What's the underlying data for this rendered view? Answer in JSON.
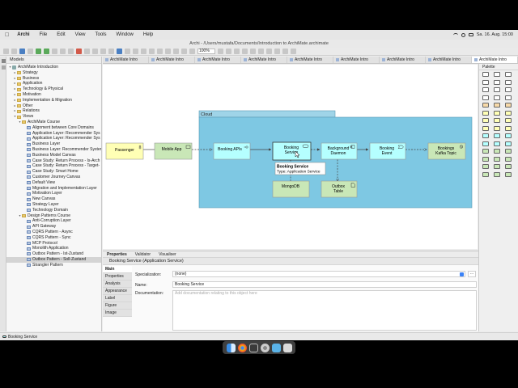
{
  "menubar": {
    "app": "Archi",
    "items": [
      "File",
      "Edit",
      "View",
      "Tools",
      "Window",
      "Help"
    ],
    "clock": "Sa. 16. Aug.  15:00"
  },
  "window": {
    "title": "Archi - /Users/mustafa/Documents/Introduction to ArchiMate.archimate"
  },
  "toolbar": {
    "zoom": "100%"
  },
  "models": {
    "header": "Models",
    "tree": [
      {
        "label": "ArchiMate Introduction",
        "level": 0,
        "icon": "model",
        "twisty": "open"
      },
      {
        "label": "Strategy",
        "level": 1,
        "icon": "folder",
        "twisty": "closed"
      },
      {
        "label": "Business",
        "level": 1,
        "icon": "folder",
        "twisty": "closed"
      },
      {
        "label": "Application",
        "level": 1,
        "icon": "folder",
        "twisty": "closed"
      },
      {
        "label": "Technology & Physical",
        "level": 1,
        "icon": "folder",
        "twisty": "closed"
      },
      {
        "label": "Motivation",
        "level": 1,
        "icon": "folder",
        "twisty": "closed"
      },
      {
        "label": "Implementation & Migration",
        "level": 1,
        "icon": "folder",
        "twisty": "closed"
      },
      {
        "label": "Other",
        "level": 1,
        "icon": "folder",
        "twisty": "closed"
      },
      {
        "label": "Relations",
        "level": 1,
        "icon": "folder",
        "twisty": "closed"
      },
      {
        "label": "Views",
        "level": 1,
        "icon": "folder",
        "twisty": "open"
      },
      {
        "label": "ArchiMate Course",
        "level": 2,
        "icon": "folder",
        "twisty": "open"
      },
      {
        "label": "Alignment between Core Domains",
        "level": 3,
        "icon": "view"
      },
      {
        "label": "Application Layer: Recommender Sys",
        "level": 3,
        "icon": "view"
      },
      {
        "label": "Application Layer: Recommender Sys",
        "level": 3,
        "icon": "view"
      },
      {
        "label": "Business Layer",
        "level": 3,
        "icon": "view"
      },
      {
        "label": "Business Layer: Recommender Syster",
        "level": 3,
        "icon": "view"
      },
      {
        "label": "Business Model Canvas",
        "level": 3,
        "icon": "view"
      },
      {
        "label": "Case Study: Return Process - Is-Arch",
        "level": 3,
        "icon": "view"
      },
      {
        "label": "Case Study: Return Process - Target-",
        "level": 3,
        "icon": "view"
      },
      {
        "label": "Case Study: Smart Home",
        "level": 3,
        "icon": "view"
      },
      {
        "label": "Customer Journey Canvas",
        "level": 3,
        "icon": "view"
      },
      {
        "label": "Default View",
        "level": 3,
        "icon": "view"
      },
      {
        "label": "Migration and Implementation Layer",
        "level": 3,
        "icon": "view"
      },
      {
        "label": "Motivation Layer",
        "level": 3,
        "icon": "view"
      },
      {
        "label": "New Canvas",
        "level": 3,
        "icon": "view"
      },
      {
        "label": "Strategy Layer",
        "level": 3,
        "icon": "view"
      },
      {
        "label": "Technology Domain",
        "level": 3,
        "icon": "view"
      },
      {
        "label": "Design Patterns Course",
        "level": 2,
        "icon": "folder",
        "twisty": "open"
      },
      {
        "label": "Anti-Corruption Layer",
        "level": 3,
        "icon": "view"
      },
      {
        "label": "API Gateway",
        "level": 3,
        "icon": "view"
      },
      {
        "label": "CQRS Pattern - Async",
        "level": 3,
        "icon": "view"
      },
      {
        "label": "CQRS Pattern - Sync",
        "level": 3,
        "icon": "view"
      },
      {
        "label": "MCP Protocol",
        "level": 3,
        "icon": "view"
      },
      {
        "label": "Monolith Application",
        "level": 3,
        "icon": "view"
      },
      {
        "label": "Outbox Pattern - Ist-Zustand",
        "level": 3,
        "icon": "view"
      },
      {
        "label": "Outbox Pattern - Soll-Zustand",
        "level": 3,
        "icon": "view",
        "selected": true
      },
      {
        "label": "Strangler Pattern",
        "level": 3,
        "icon": "view"
      }
    ]
  },
  "tabs": [
    "ArchiMate Intro",
    "ArchiMate Intro",
    "ArchiMate Intro",
    "ArchiMate Intro",
    "ArchiMate Intro",
    "ArchiMate Intro",
    "ArchiMate Intro",
    "ArchiMate Intro",
    "ArchiMate Intro"
  ],
  "diagram": {
    "group_label": "Cloud",
    "nodes": {
      "passenger": "Passenger",
      "mobile_app": "Mobile App",
      "booking_apis": "Booking APIs",
      "booking_service": [
        "Booking",
        "Service"
      ],
      "background_daemon": [
        "Background",
        "Daemon"
      ],
      "booking_event": [
        "Booking",
        "Event"
      ],
      "kafka_topic": [
        "Bookings",
        "Kafka Topic"
      ],
      "mongodb": "MongoDB",
      "outbox_table": [
        "Outbox",
        "Table"
      ]
    },
    "tooltip": {
      "title": "Booking Service",
      "type": "Type: Application Service"
    },
    "colors": {
      "business": "#ffffb5",
      "application": "#b5ffff",
      "technology": "#c9e7b7",
      "group": "#7ec8e3"
    }
  },
  "palette": {
    "title": "Palette"
  },
  "properties": {
    "tabs": [
      "Properties",
      "Validator",
      "Visualiser"
    ],
    "title": "Booking Service (Application Service)",
    "sections": [
      "Main",
      "Properties",
      "Analysis",
      "Appearance",
      "Label",
      "Figure",
      "Image"
    ],
    "specialization_label": "Specialization:",
    "specialization_value": "(none)",
    "name_label": "Name:",
    "name_value": "Booking Service",
    "documentation_label": "Documentation:",
    "documentation_placeholder": "Add documentation relating to this object here"
  },
  "statusbar": {
    "text": "Booking Service"
  }
}
